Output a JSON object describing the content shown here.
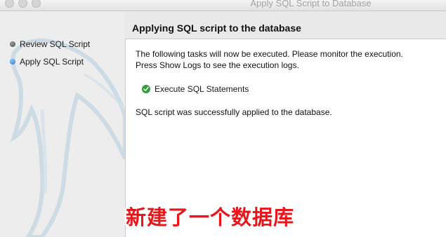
{
  "window": {
    "title": "Apply SQL Script to Database"
  },
  "sidebar": {
    "steps": [
      {
        "label": "Review SQL Script",
        "state": "done"
      },
      {
        "label": "Apply SQL Script",
        "state": "current"
      }
    ]
  },
  "header": {
    "title": "Applying SQL script to the database"
  },
  "main": {
    "description_line1": "The following tasks will now be executed. Please monitor the execution.",
    "description_line2": "Press Show Logs to see the execution logs.",
    "tasks": [
      {
        "label": "Execute SQL Statements",
        "status": "success",
        "icon": "check-circle-icon",
        "color": "#2f9e3a"
      }
    ],
    "result_message": "SQL script was successfully applied to the database."
  },
  "overlay": {
    "caption": "新建了一个数据库",
    "color": "#e8151b"
  }
}
